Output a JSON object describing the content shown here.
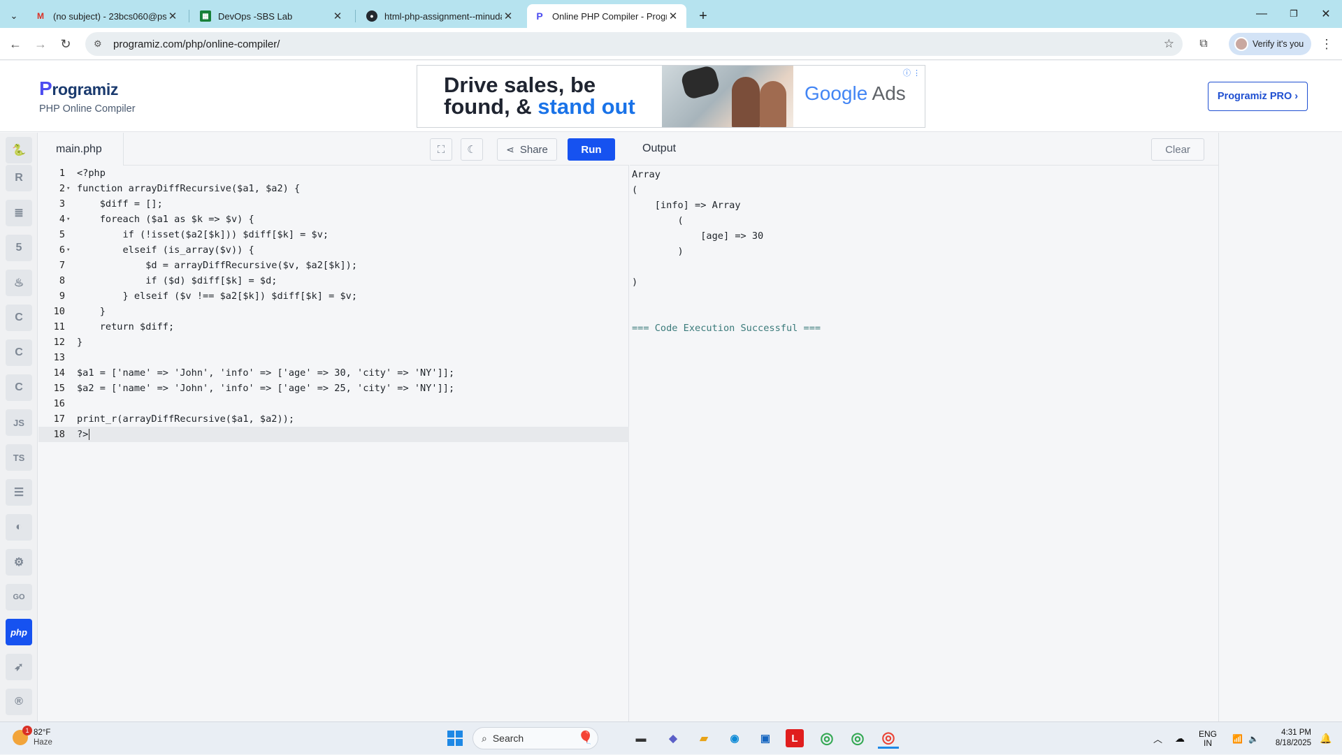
{
  "browser": {
    "tabs": [
      {
        "title": "(no subject) - 23bcs060@psgrk",
        "icon": "gmail-icon"
      },
      {
        "title": "DevOps -SBS Lab",
        "icon": "sheets-icon"
      },
      {
        "title": "html-php-assignment--minuda",
        "icon": "github-icon"
      },
      {
        "title": "Online PHP Compiler - Program",
        "icon": "programiz-icon"
      }
    ],
    "url": "programiz.com/php/online-compiler/",
    "verify_label": "Verify it's you"
  },
  "header": {
    "logo": "rogramiz",
    "logo_p": "P",
    "subtitle": "PHP Online Compiler",
    "pro_button": "Programiz PRO ›"
  },
  "ad": {
    "line1": "Drive sales, be",
    "line2_prefix": "found, & ",
    "line2_highlight": "stand out",
    "brand_g": "Google",
    "brand_rest": " Ads"
  },
  "sidebar": {
    "languages": [
      "python",
      "r",
      "sql",
      "html",
      "java",
      "c",
      "c++",
      "c#",
      "JS",
      "TS",
      "go-lang",
      "swift",
      "kotlin",
      "dart",
      "GO",
      "php",
      "swift",
      "rust"
    ]
  },
  "editor": {
    "filename": "main.php",
    "share_label": "Share",
    "run_label": "Run",
    "lines": [
      {
        "n": "1",
        "fold": "",
        "code": "<?php"
      },
      {
        "n": "2",
        "fold": "▾",
        "code": "function arrayDiffRecursive($a1, $a2) {"
      },
      {
        "n": "3",
        "fold": "",
        "code": "    $diff = [];"
      },
      {
        "n": "4",
        "fold": "▾",
        "code": "    foreach ($a1 as $k => $v) {"
      },
      {
        "n": "5",
        "fold": "",
        "code": "        if (!isset($a2[$k])) $diff[$k] = $v;"
      },
      {
        "n": "6",
        "fold": "▾",
        "code": "        elseif (is_array($v)) {"
      },
      {
        "n": "7",
        "fold": "",
        "code": "            $d = arrayDiffRecursive($v, $a2[$k]);"
      },
      {
        "n": "8",
        "fold": "",
        "code": "            if ($d) $diff[$k] = $d;"
      },
      {
        "n": "9",
        "fold": "",
        "code": "        } elseif ($v !== $a2[$k]) $diff[$k] = $v;"
      },
      {
        "n": "10",
        "fold": "",
        "code": "    }"
      },
      {
        "n": "11",
        "fold": "",
        "code": "    return $diff;"
      },
      {
        "n": "12",
        "fold": "",
        "code": "}"
      },
      {
        "n": "13",
        "fold": "",
        "code": ""
      },
      {
        "n": "14",
        "fold": "",
        "code": "$a1 = ['name' => 'John', 'info' => ['age' => 30, 'city' => 'NY']];"
      },
      {
        "n": "15",
        "fold": "",
        "code": "$a2 = ['name' => 'John', 'info' => ['age' => 25, 'city' => 'NY']];"
      },
      {
        "n": "16",
        "fold": "",
        "code": ""
      },
      {
        "n": "17",
        "fold": "",
        "code": "print_r(arrayDiffRecursive($a1, $a2));"
      },
      {
        "n": "18",
        "fold": "",
        "code": "?>"
      }
    ]
  },
  "output": {
    "title": "Output",
    "clear_label": "Clear",
    "text": "Array\n(\n    [info] => Array\n        (\n            [age] => 30\n        )\n\n)\n\n\n",
    "status": "=== Code Execution Successful ==="
  },
  "taskbar": {
    "weather_temp": "82°F",
    "weather_desc": "Haze",
    "weather_badge": "1",
    "search_label": "Search",
    "lang_line1": "ENG",
    "lang_line2": "IN",
    "time": "4:31 PM",
    "date": "8/18/2025"
  },
  "colors": {
    "accent": "#1652f0",
    "tabbar": "#b6e3ef",
    "ad_blue": "#1a73e8"
  }
}
